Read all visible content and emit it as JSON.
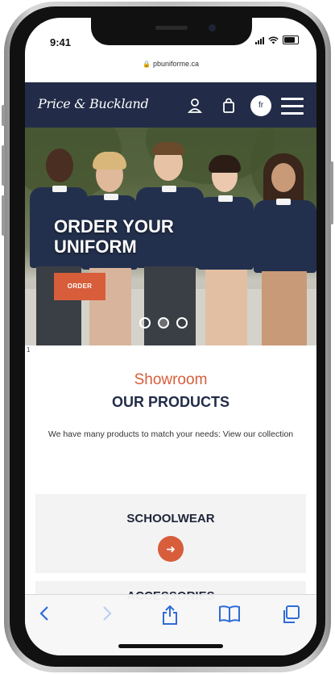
{
  "status_bar": {
    "time": "9:41"
  },
  "browser": {
    "url": "pbuniforme.ca"
  },
  "site_nav": {
    "logo": "Price & Buckland",
    "lang_button": "fr"
  },
  "hero": {
    "title_line1": "ORDER YOUR",
    "title_line2": "UNIFORM",
    "order_button": "ORDER",
    "slide_count": 3,
    "active_slide": 2
  },
  "marker": "1",
  "products": {
    "subtitle": "Showroom",
    "title": "OUR PRODUCTS",
    "description": "We have many products to match your needs: View our collection",
    "cards": [
      {
        "title": "SCHOOLWEAR"
      },
      {
        "title": "ACCESSORIES"
      }
    ]
  },
  "colors": {
    "navy": "#222c48",
    "accent": "#d75d3b",
    "ios_blue": "#2e6bd8"
  },
  "toolbar": {
    "icons": [
      "back-icon",
      "forward-icon",
      "share-icon",
      "bookmarks-icon",
      "tabs-icon"
    ]
  }
}
